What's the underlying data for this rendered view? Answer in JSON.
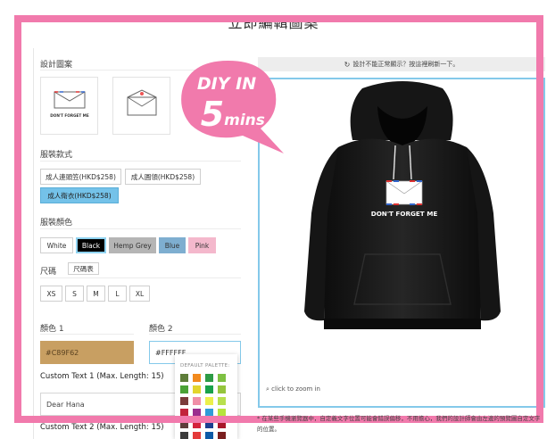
{
  "header": {
    "title": "立即編輯圖案"
  },
  "design": {
    "label": "設計圖案",
    "thumb_text": "DON'T FORGET ME"
  },
  "style": {
    "label": "服裝款式",
    "options": [
      "成人連頭笠(HKD$258)",
      "成人圓領(HKD$258)",
      "成人衛衣(HKD$258)"
    ],
    "selected": "成人衛衣(HKD$258)"
  },
  "clothing_color": {
    "label": "服裝顏色",
    "options": [
      {
        "label": "White",
        "color": "#ffffff",
        "text": "#333333"
      },
      {
        "label": "Black",
        "color": "#000000",
        "text": "#ffffff"
      },
      {
        "label": "Hemp Grey",
        "color": "#b5b5b5",
        "text": "#333333"
      },
      {
        "label": "Blue",
        "color": "#7eaed0",
        "text": "#222222"
      },
      {
        "label": "Pink",
        "color": "#f4b8cc",
        "text": "#333333"
      }
    ],
    "selected": "Black"
  },
  "size": {
    "label": "尺碼",
    "chart_button": "尺碼表",
    "options": [
      "XS",
      "S",
      "M",
      "L",
      "XL"
    ]
  },
  "colors": {
    "color1_label": "顏色 1",
    "color1_value": "#C89F62",
    "color2_label": "顏色 2",
    "color2_value": "#FFFFFF"
  },
  "palette": {
    "title": "DEFAULT PALETTE:",
    "swatches": [
      "#5e7d3a",
      "#f28a1e",
      "#2d9b46",
      "#7ec142",
      "#4aa236",
      "#e3d52e",
      "#19a24a",
      "#95c53d",
      "#7a3b3a",
      "#f08fa8",
      "#ecf04b",
      "#b8e04e",
      "#c2243c",
      "#9b2d8e",
      "#2f9cd8",
      "#b6e43d",
      "#5e3d3a",
      "#d3223b",
      "#1d3f8f",
      "#a8172a",
      "#3b3b3b",
      "#e43b3b",
      "#0c5aa6",
      "#7a1f1f"
    ]
  },
  "custom_text": {
    "label1": "Custom Text 1 (Max. Length: 15)",
    "value1": "Dear Hana",
    "label2": "Custom Text 2 (Max. Length: 15)"
  },
  "preview": {
    "notice": "設計不能正常顯示？按這裡刷新一下。",
    "zoom_hint": "click to zoom in",
    "print_text": "DON'T FORGET ME",
    "footnote": "* 在某些手機瀏覽器中，自定義文字位置可能會錯誤偏移，不用擔心，我們的設計師會由左邊的預覽圖自定文字的位置。"
  },
  "badge": {
    "line1": "DIY IN",
    "number": "5",
    "unit": "mins"
  },
  "theme": {
    "accent_pink": "#f17aac",
    "accent_blue": "#74c2e9",
    "hoodie": "#141414"
  }
}
